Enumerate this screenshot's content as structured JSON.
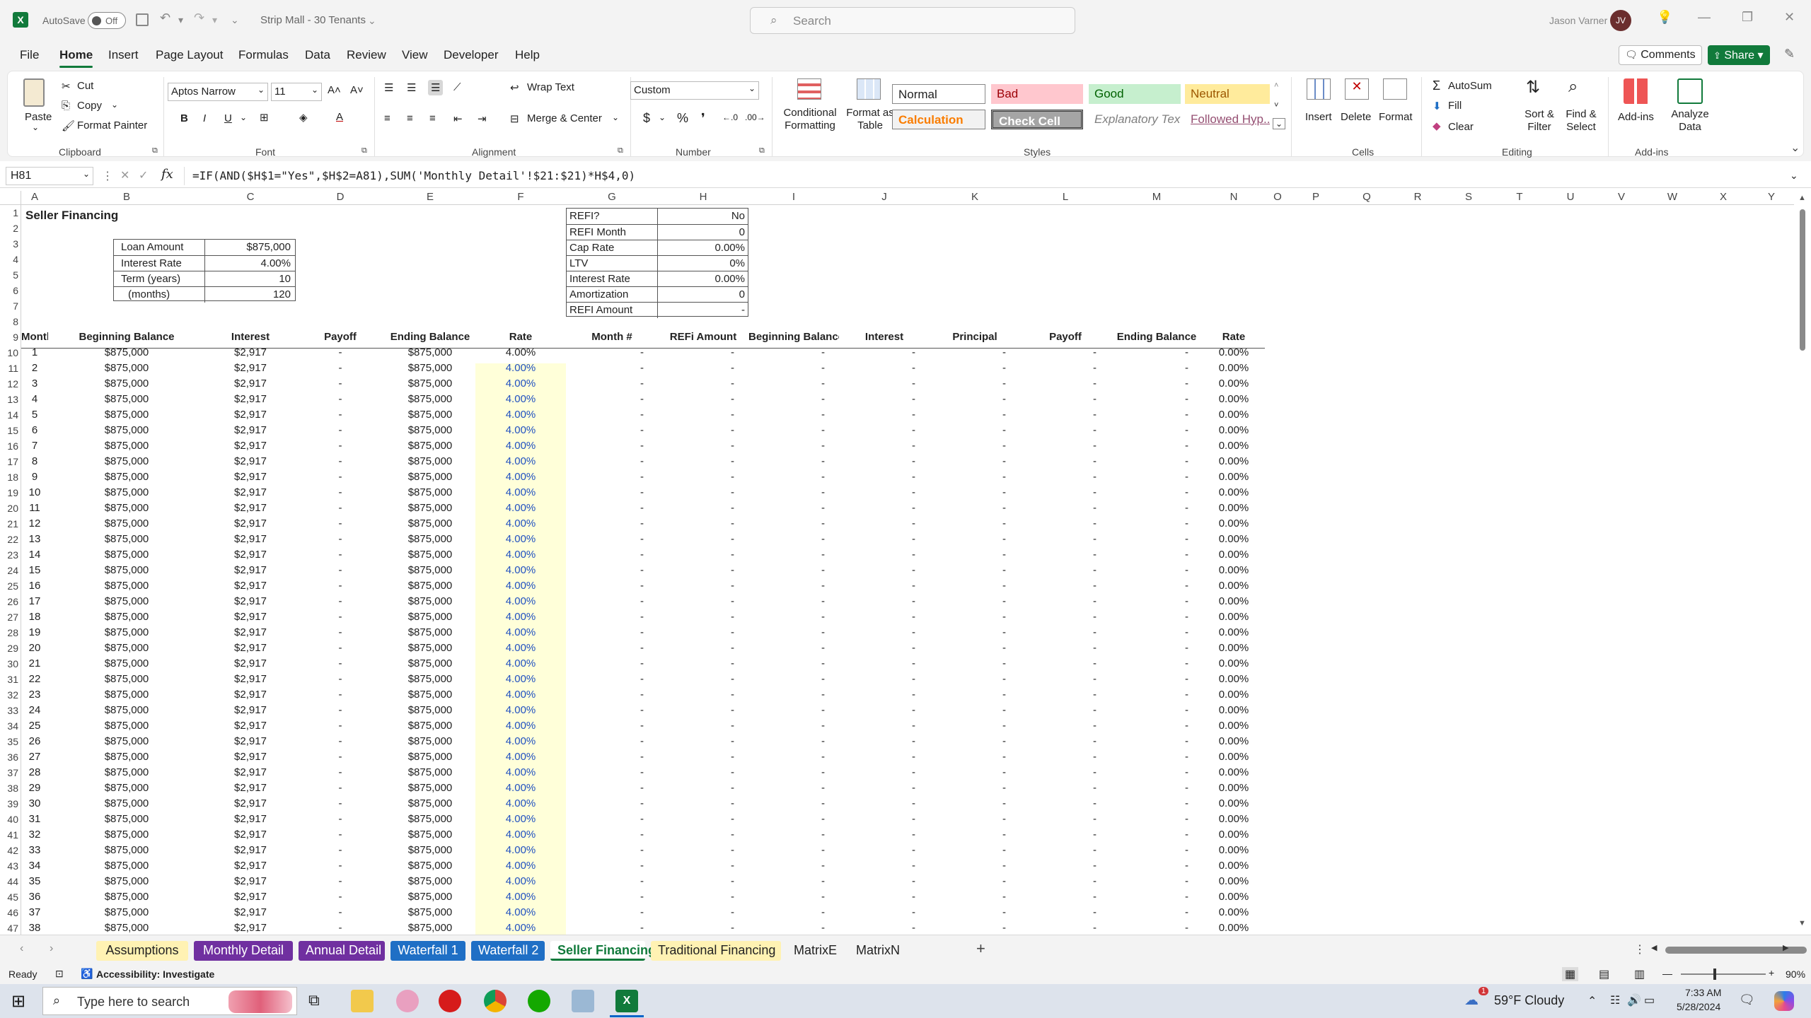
{
  "app": {
    "autosave_label": "AutoSave",
    "autosave_state": "Off",
    "doc_title": "Strip Mall - 30 Tenants",
    "search_placeholder": "Search",
    "user_name": "Jason Varner",
    "user_initials": "JV"
  },
  "menu": {
    "items": [
      "File",
      "Home",
      "Insert",
      "Page Layout",
      "Formulas",
      "Data",
      "Review",
      "View",
      "Developer",
      "Help"
    ],
    "active": "Home",
    "comments": "Comments",
    "share": "Share"
  },
  "ribbon": {
    "clipboard": {
      "paste": "Paste",
      "cut": "Cut",
      "copy": "Copy",
      "format_painter": "Format Painter",
      "label": "Clipboard"
    },
    "font": {
      "name": "Aptos Narrow",
      "size": "11",
      "label": "Font"
    },
    "alignment": {
      "wrap": "Wrap Text",
      "merge": "Merge & Center",
      "label": "Alignment"
    },
    "number": {
      "format": "Custom",
      "label": "Number"
    },
    "styles": {
      "conditional": "Conditional Formatting",
      "format_table": "Format as Table",
      "normal": "Normal",
      "bad": "Bad",
      "good": "Good",
      "neutral": "Neutral",
      "calculation": "Calculation",
      "check": "Check Cell",
      "explanatory": "Explanatory Text",
      "followed": "Followed Hyp...",
      "label": "Styles"
    },
    "cells": {
      "insert": "Insert",
      "delete": "Delete",
      "format": "Format",
      "label": "Cells"
    },
    "editing": {
      "autosum": "AutoSum",
      "fill": "Fill",
      "clear": "Clear",
      "sort": "Sort & Filter",
      "find": "Find & Select",
      "label": "Editing"
    },
    "addins": {
      "addins": "Add-ins",
      "analyze": "Analyze Data",
      "label": "Add-ins"
    }
  },
  "formula_bar": {
    "name_box": "H81",
    "formula": "=IF(AND($H$1=\"Yes\",$H$2=A81),SUM('Monthly Detail'!$21:$21)*H$4,0)"
  },
  "grid": {
    "columns": [
      "A",
      "B",
      "C",
      "D",
      "E",
      "F",
      "G",
      "H",
      "I",
      "J",
      "K",
      "L",
      "M",
      "N",
      "O",
      "P",
      "Q",
      "R",
      "S",
      "T",
      "U",
      "V",
      "W",
      "X",
      "Y"
    ],
    "title": "Seller Financing",
    "loan_table": [
      {
        "label": "Loan Amount",
        "value": "$875,000"
      },
      {
        "label": "Interest Rate",
        "value": "4.00%"
      },
      {
        "label": "Term (years)",
        "value": "10"
      },
      {
        "label": "(months)",
        "value": "120"
      }
    ],
    "refi_table": [
      {
        "label": "REFI?",
        "value": "No"
      },
      {
        "label": "REFI Month",
        "value": "0"
      },
      {
        "label": "Cap Rate",
        "value": "0.00%"
      },
      {
        "label": "LTV",
        "value": "0%"
      },
      {
        "label": "Interest Rate",
        "value": "0.00%"
      },
      {
        "label": "Amortization",
        "value": "0"
      },
      {
        "label": "REFI Amount",
        "value": "-"
      }
    ],
    "headers": [
      "Month #",
      "Beginning Balance",
      "Interest",
      "Payoff",
      "Ending Balance",
      "Rate",
      "Month #",
      "REFi Amount",
      "Beginning Balance",
      "Interest",
      "Principal",
      "Payoff",
      "Ending Balance",
      "Rate"
    ],
    "row_numbers": [
      "1",
      "2",
      "3",
      "4",
      "5",
      "6",
      "7",
      "8",
      "9",
      "10",
      "11",
      "12",
      "13",
      "14",
      "15",
      "16",
      "17",
      "18",
      "19",
      "20",
      "21",
      "22",
      "23",
      "24",
      "25",
      "26",
      "27",
      "28",
      "29",
      "30",
      "31",
      "32",
      "33",
      "34",
      "35",
      "36",
      "37",
      "38",
      "39",
      "40",
      "41",
      "42",
      "43",
      "44",
      "45",
      "46",
      "47"
    ],
    "months": [
      "1",
      "2",
      "3",
      "4",
      "5",
      "6",
      "7",
      "8",
      "9",
      "10",
      "11",
      "12",
      "13",
      "14",
      "15",
      "16",
      "17",
      "18",
      "19",
      "20",
      "21",
      "22",
      "23",
      "24",
      "25",
      "26",
      "27",
      "28",
      "29",
      "30",
      "31",
      "32",
      "33",
      "34",
      "35",
      "36",
      "37",
      "38"
    ],
    "row_values": {
      "beginning_balance": "$875,000",
      "interest": "$2,917",
      "payoff": "-",
      "ending_balance": "$875,000",
      "rate": "4.00%",
      "dash": "-",
      "refi_rate": "0.00%"
    }
  },
  "sheet_tabs": [
    {
      "name": "Assumptions",
      "color": "#fff2b3",
      "text": "#222"
    },
    {
      "name": "Monthly Detail",
      "color": "#7030a0",
      "text": "#fff"
    },
    {
      "name": "Annual Detail",
      "color": "#7030a0",
      "text": "#fff"
    },
    {
      "name": "Waterfall 1",
      "color": "#1f6fc5",
      "text": "#fff"
    },
    {
      "name": "Waterfall 2",
      "color": "#1f6fc5",
      "text": "#fff"
    },
    {
      "name": "Seller Financing",
      "color": "#ffffff",
      "text": "#117a3b"
    },
    {
      "name": "Traditional Financing",
      "color": "#fff2b3",
      "text": "#222"
    },
    {
      "name": "MatrixE",
      "color": "transparent",
      "text": "#222"
    },
    {
      "name": "MatrixN",
      "color": "transparent",
      "text": "#222"
    }
  ],
  "status": {
    "ready": "Ready",
    "accessibility": "Accessibility: Investigate",
    "zoom": "90%"
  },
  "taskbar": {
    "search": "Type here to search",
    "weather": "59°F  Cloudy",
    "time": "7:33 AM",
    "date": "5/28/2024",
    "notif": "1"
  },
  "colors": {
    "excel_green": "#117a3b",
    "rate_highlight": "#ffffd9",
    "rate_text": "#2050c0"
  }
}
